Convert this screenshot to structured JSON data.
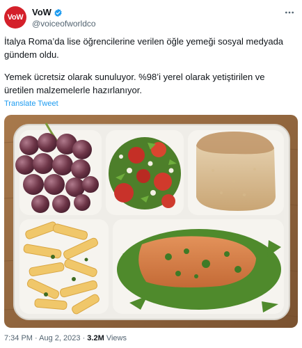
{
  "tweet": {
    "avatar_text": "VoW",
    "display_name": "VoW",
    "handle": "@voiceofworldco",
    "more_icon": "more-horizontal-icon",
    "verified_icon": "verified-badge-icon",
    "paragraph1": "İtalya Roma’da lise öğrencilerine verilen öğle yemeği sosyal medyada gündem oldu.",
    "paragraph2": "Yemek ücretsiz olarak sunuluyor. %98’i yerel olarak yetiştirilen ve üretilen malzemelerle hazırlanıyor.",
    "translate_label": "Translate Tweet",
    "time": "7:34 PM",
    "separator": "·",
    "date": "Aug 2, 2023",
    "views_count": "3.2M",
    "views_label": "Views"
  },
  "colors": {
    "brand_red": "#d4202a",
    "verified_blue": "#1d9bf0",
    "link_blue": "#1d9bf0",
    "secondary_text": "#536471"
  }
}
